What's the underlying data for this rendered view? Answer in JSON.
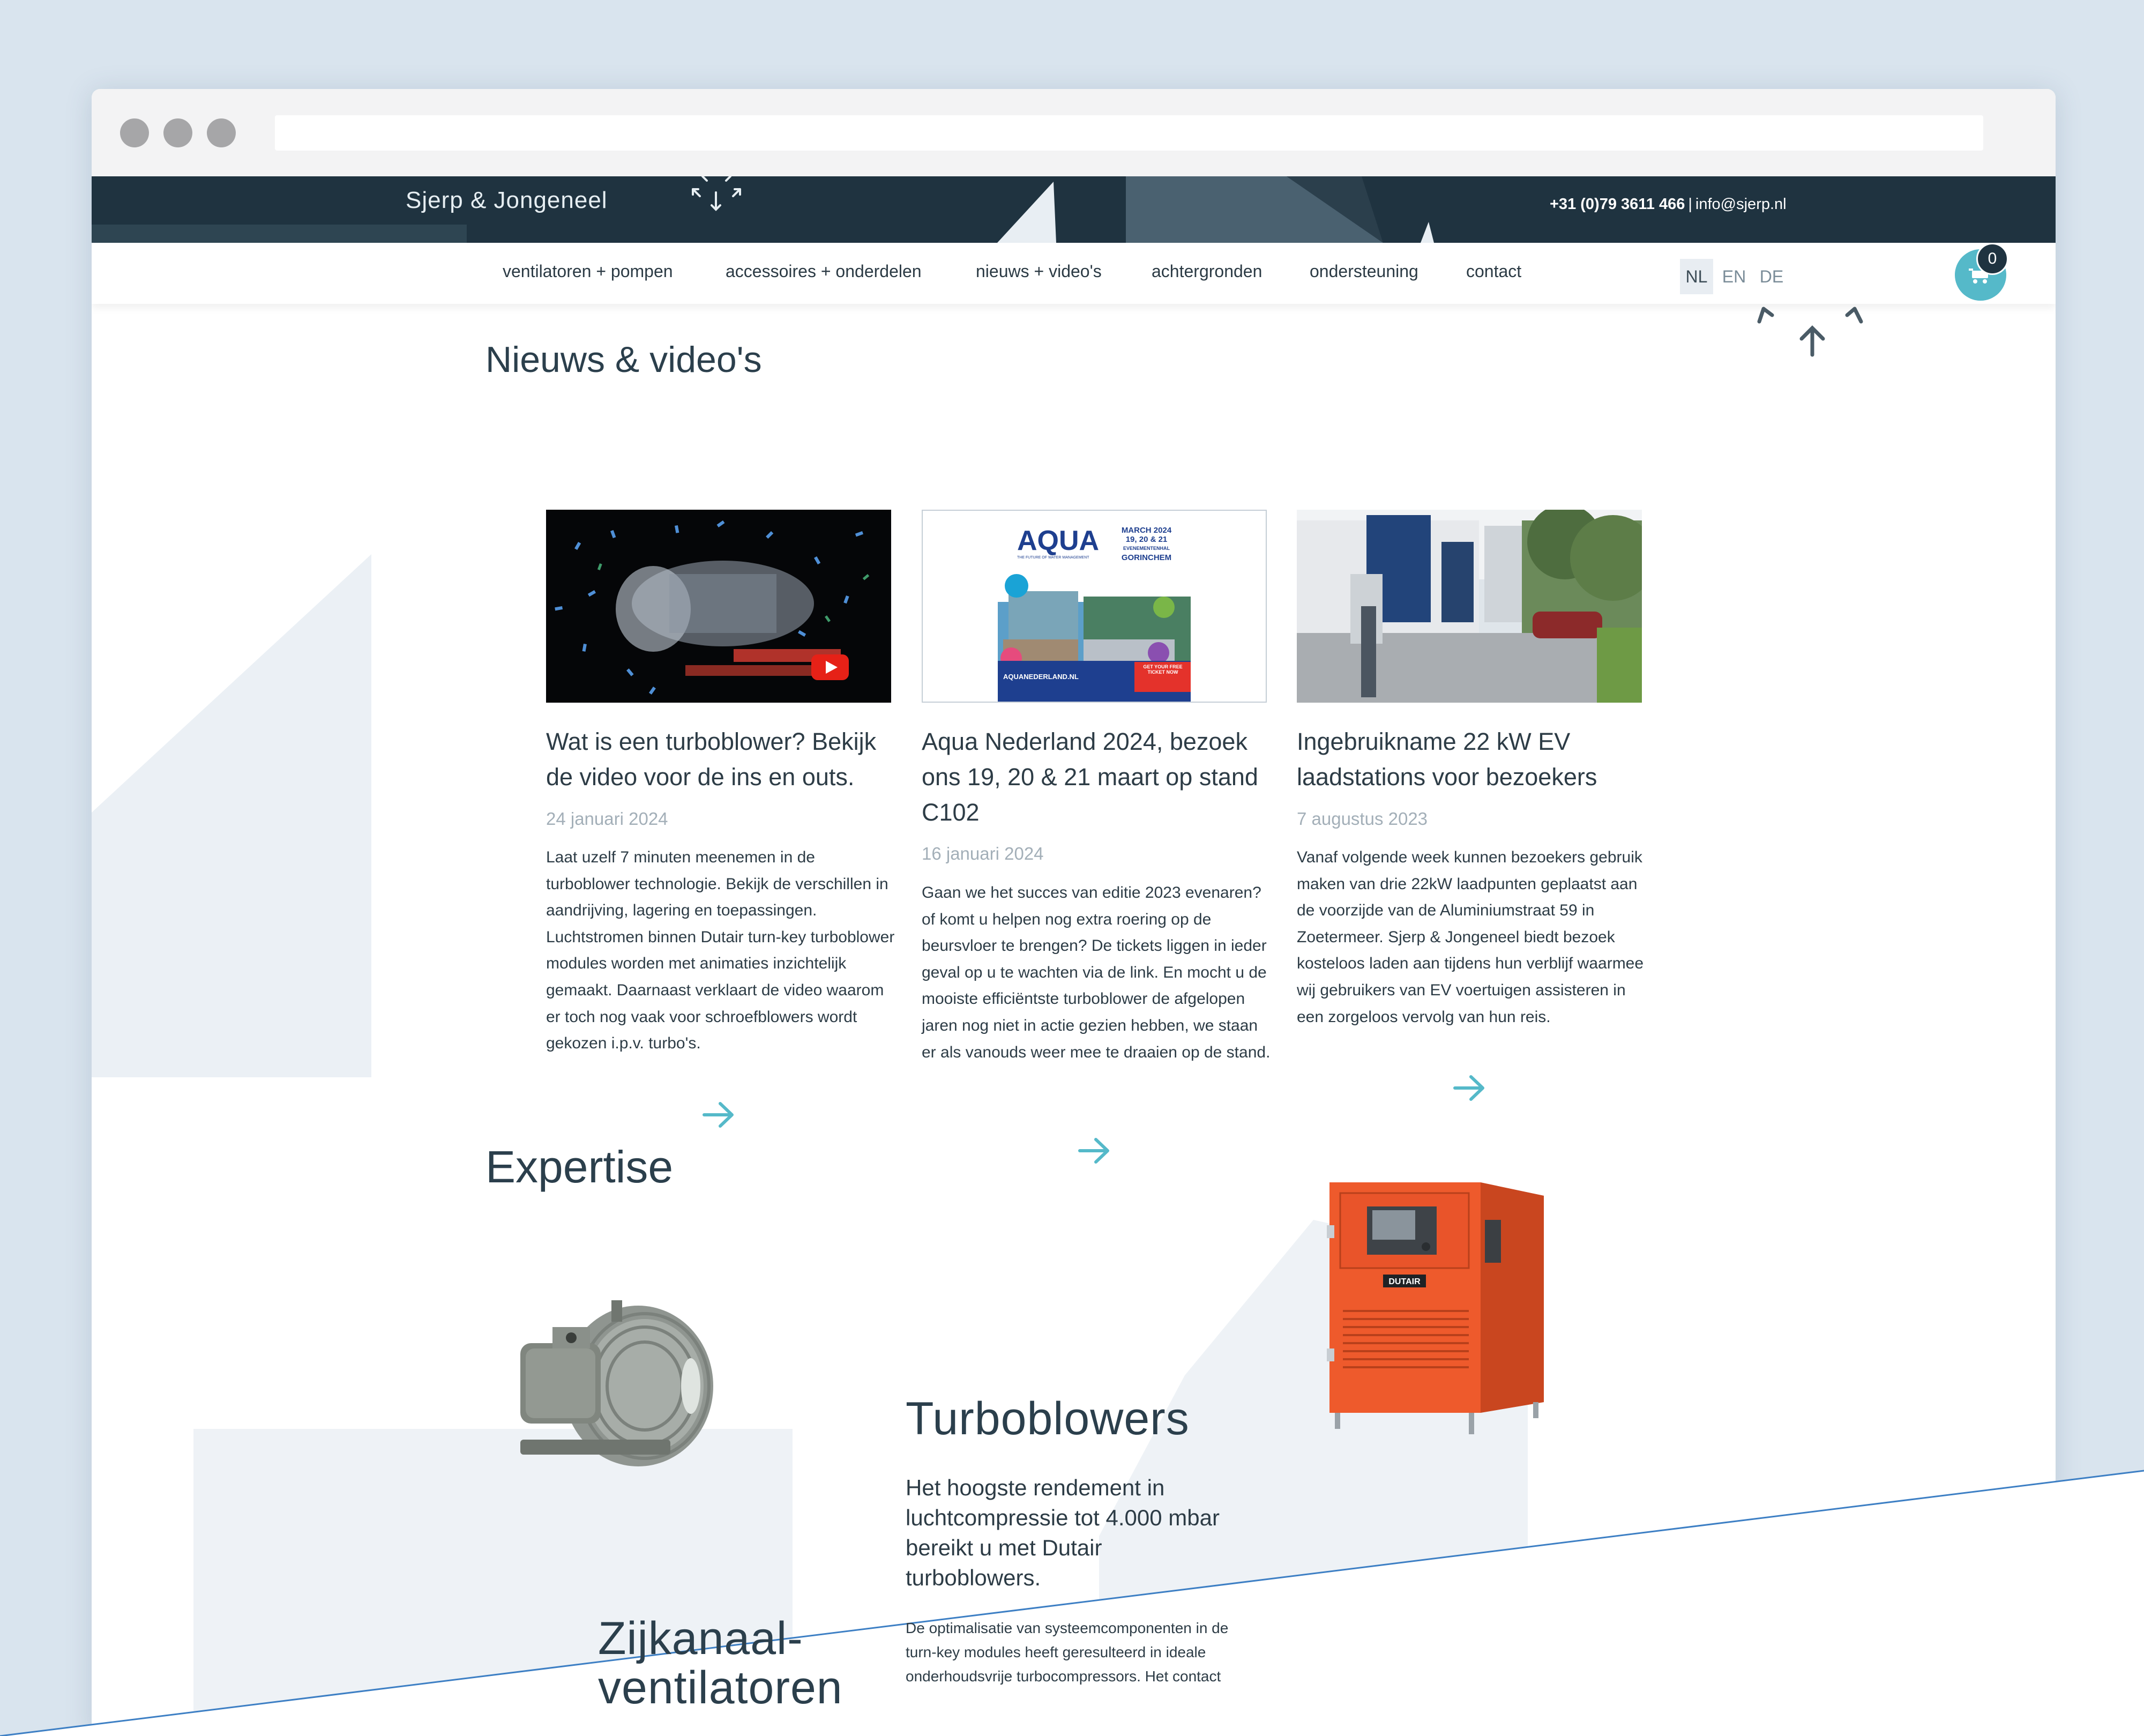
{
  "header": {
    "brand": "Sjerp & Jongeneel",
    "phone": "+31 (0)79 3611 466",
    "separator": "|",
    "email": "info@sjerp.nl"
  },
  "nav": {
    "items": [
      {
        "label": "ventilatoren + pompen"
      },
      {
        "label": "accessoires + onderdelen"
      },
      {
        "label": "nieuws + video's"
      },
      {
        "label": "achtergronden"
      },
      {
        "label": "ondersteuning"
      },
      {
        "label": "contact"
      }
    ],
    "languages": [
      "NL",
      "EN",
      "DE"
    ],
    "active_language": "NL",
    "cart_count": "0"
  },
  "news": {
    "heading": "Nieuws & video's",
    "cards": [
      {
        "title": "Wat is een turboblower? Bekijk de video voor de ins en outs.",
        "date": "24 januari 2024",
        "text": "Laat uzelf 7 minuten meenemen in de turboblower technologie. Bekijk de verschillen in aandrijving, lagering en toepassingen. Luchtstromen binnen Dutair turn-key turboblower modules worden met animaties inzichtelijk gemaakt. Daarnaast verklaart de video waarom er toch nog vaak voor schroefblowers wordt gekozen i.p.v. turbo's.",
        "image": "video-thumbnail"
      },
      {
        "title": "Aqua Nederland 2024, bezoek ons 19, 20 & 21 maart op stand C102",
        "date": "16 januari 2024",
        "text": "Gaan we het succes van editie 2023 evenaren? of komt u helpen nog extra roering op de beursvloer te brengen? De tickets liggen in ieder geval op u te wachten via de link. En mocht u de mooiste efficiëntste turboblower de afgelopen jaren nog niet in actie gezien hebben, we staan er als vanouds weer mee te draaien op de stand.",
        "image": "aqua-banner",
        "banner": {
          "logo": "AQUA",
          "tagline": "THE FUTURE OF WATER MANAGEMENT",
          "event_line1": "MARCH 2024",
          "event_line2": "19, 20 & 21",
          "event_line3": "EVENEMENTENHAL",
          "event_line4": "GORINCHEM",
          "site": "AQUANEDERLAND.NL",
          "ticket": "GET YOUR FREE TICKET NOW"
        }
      },
      {
        "title": "Ingebruikname 22 kW EV laadstations voor bezoekers",
        "date": "7 augustus 2023",
        "text": "Vanaf volgende week kunnen bezoekers gebruik maken van drie 22kW laadpunten geplaatst aan de voorzijde van de Aluminiumstraat 59 in Zoetermeer. Sjerp & Jongeneel biedt bezoek kosteloos laden aan tijdens hun verblijf waarmee wij gebruikers van EV voertuigen assisteren in een zorgeloos vervolg van hun reis.",
        "image": "building-photo"
      }
    ]
  },
  "expertise": {
    "heading": "Expertise",
    "items": [
      {
        "title_line1": "Zijkanaal-",
        "title_line2": "ventilatoren",
        "image": "side-channel-blower"
      },
      {
        "title": "Turboblowers",
        "subtitle": "Het hoogste rendement in luchtcompressie tot 4.000 mbar bereikt u met Dutair turboblowers.",
        "text": "De optimalisatie van systeemcomponenten in de turn-key modules heeft geresulteerd in ideale onderhoudsvrije turbocompressors. Het contact",
        "brand_plate": "DUTAIR",
        "image": "turboblower-cabinet"
      }
    ]
  },
  "colors": {
    "topbar": "#1f3340",
    "accent": "#55b9c9",
    "backdrop": "#d9e4ee",
    "cabinet": "#ee5a2c"
  },
  "icons": [
    "cart-icon",
    "arrow-right-icon",
    "logo-arrows-icon",
    "play-icon"
  ]
}
